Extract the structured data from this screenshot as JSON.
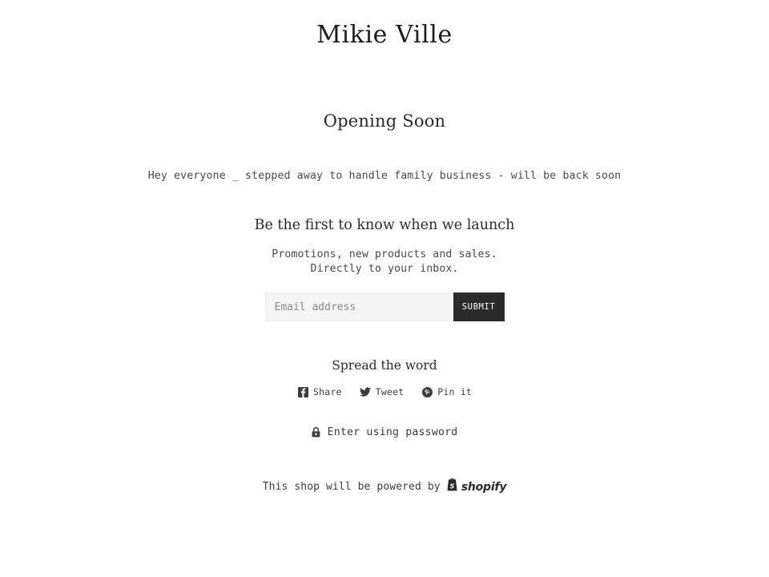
{
  "header": {
    "site_title": "Mikie Ville"
  },
  "main": {
    "opening_heading": "Opening Soon",
    "shop_message": "Hey everyone _ stepped away to handle family business - will be back soon"
  },
  "newsletter": {
    "heading": "Be the first to know when we launch",
    "subtext_line1": "Promotions, new products and sales. Directly",
    "subtext_line2": "to your inbox.",
    "email_placeholder": "Email address",
    "email_value": "",
    "submit_label": "SUBMIT"
  },
  "social": {
    "heading": "Spread the word",
    "links": [
      {
        "label": "Share",
        "icon": "facebook-icon"
      },
      {
        "label": "Tweet",
        "icon": "twitter-icon"
      },
      {
        "label": "Pin it",
        "icon": "pinterest-icon"
      }
    ]
  },
  "password": {
    "label": "Enter using password",
    "icon": "lock-icon"
  },
  "footer": {
    "powered_by_text": "This shop will be powered by",
    "shopify_wordmark": "shopify",
    "shopify_bag_letter": "S"
  },
  "colors": {
    "page_background": "#ffffff",
    "text": "#3a3a3a",
    "heading": "#2b2b2b",
    "button_background": "#2b2b2b",
    "button_text": "#ffffff",
    "input_background": "#f4f4f4",
    "placeholder": "#8b8b8b"
  }
}
